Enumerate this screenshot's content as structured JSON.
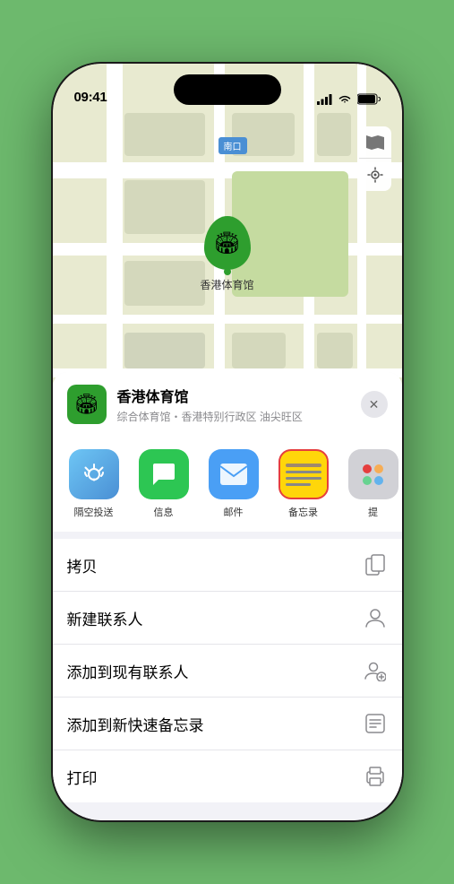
{
  "status_bar": {
    "time": "09:41",
    "location_icon": "▶"
  },
  "map": {
    "label_text": "南口",
    "venue_name": "香港体育馆",
    "pin_emoji": "🏟"
  },
  "venue_card": {
    "title": "香港体育馆",
    "subtitle": "综合体育馆・香港特别行政区 油尖旺区",
    "close_label": "×"
  },
  "share_items": [
    {
      "id": "airdrop",
      "label": "隔空投送",
      "type": "airdrop"
    },
    {
      "id": "messages",
      "label": "信息",
      "type": "messages"
    },
    {
      "id": "mail",
      "label": "邮件",
      "type": "mail"
    },
    {
      "id": "notes",
      "label": "备忘录",
      "type": "notes"
    },
    {
      "id": "more",
      "label": "提",
      "type": "more"
    }
  ],
  "actions": [
    {
      "id": "copy",
      "label": "拷贝",
      "icon": "copy"
    },
    {
      "id": "new-contact",
      "label": "新建联系人",
      "icon": "person"
    },
    {
      "id": "add-contact",
      "label": "添加到现有联系人",
      "icon": "person-add"
    },
    {
      "id": "quick-note",
      "label": "添加到新快速备忘录",
      "icon": "note"
    },
    {
      "id": "print",
      "label": "打印",
      "icon": "print"
    }
  ]
}
